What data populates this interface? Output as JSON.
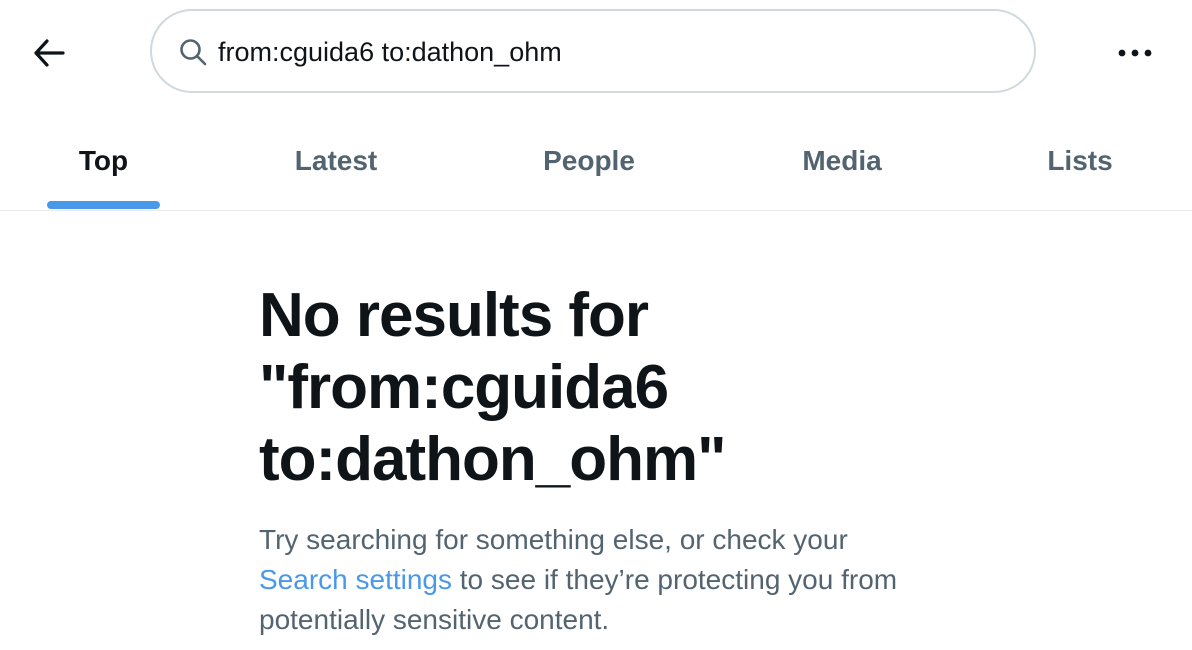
{
  "header": {
    "back_icon": "arrow-left-icon",
    "search": {
      "icon": "search-icon",
      "value": "from:cguida6 to:dathon_ohm"
    },
    "more_icon": "more-horizontal-icon"
  },
  "tabs": [
    {
      "label": "Top",
      "active": true
    },
    {
      "label": "Latest",
      "active": false
    },
    {
      "label": "People",
      "active": false
    },
    {
      "label": "Media",
      "active": false
    },
    {
      "label": "Lists",
      "active": false
    }
  ],
  "empty_state": {
    "title_line1": "No results for",
    "title_line2": "\"from:cguida6",
    "title_line3": "to:dathon_ohm\"",
    "desc_before": "Try searching for something else, or check your",
    "link_text": "Search settings",
    "desc_after": " to see if they’re protecting you from potentially sensitive content."
  },
  "colors": {
    "accent": "#4a99e9",
    "text_primary": "#0f1419",
    "text_secondary": "#536471",
    "border": "#cfd9de"
  }
}
